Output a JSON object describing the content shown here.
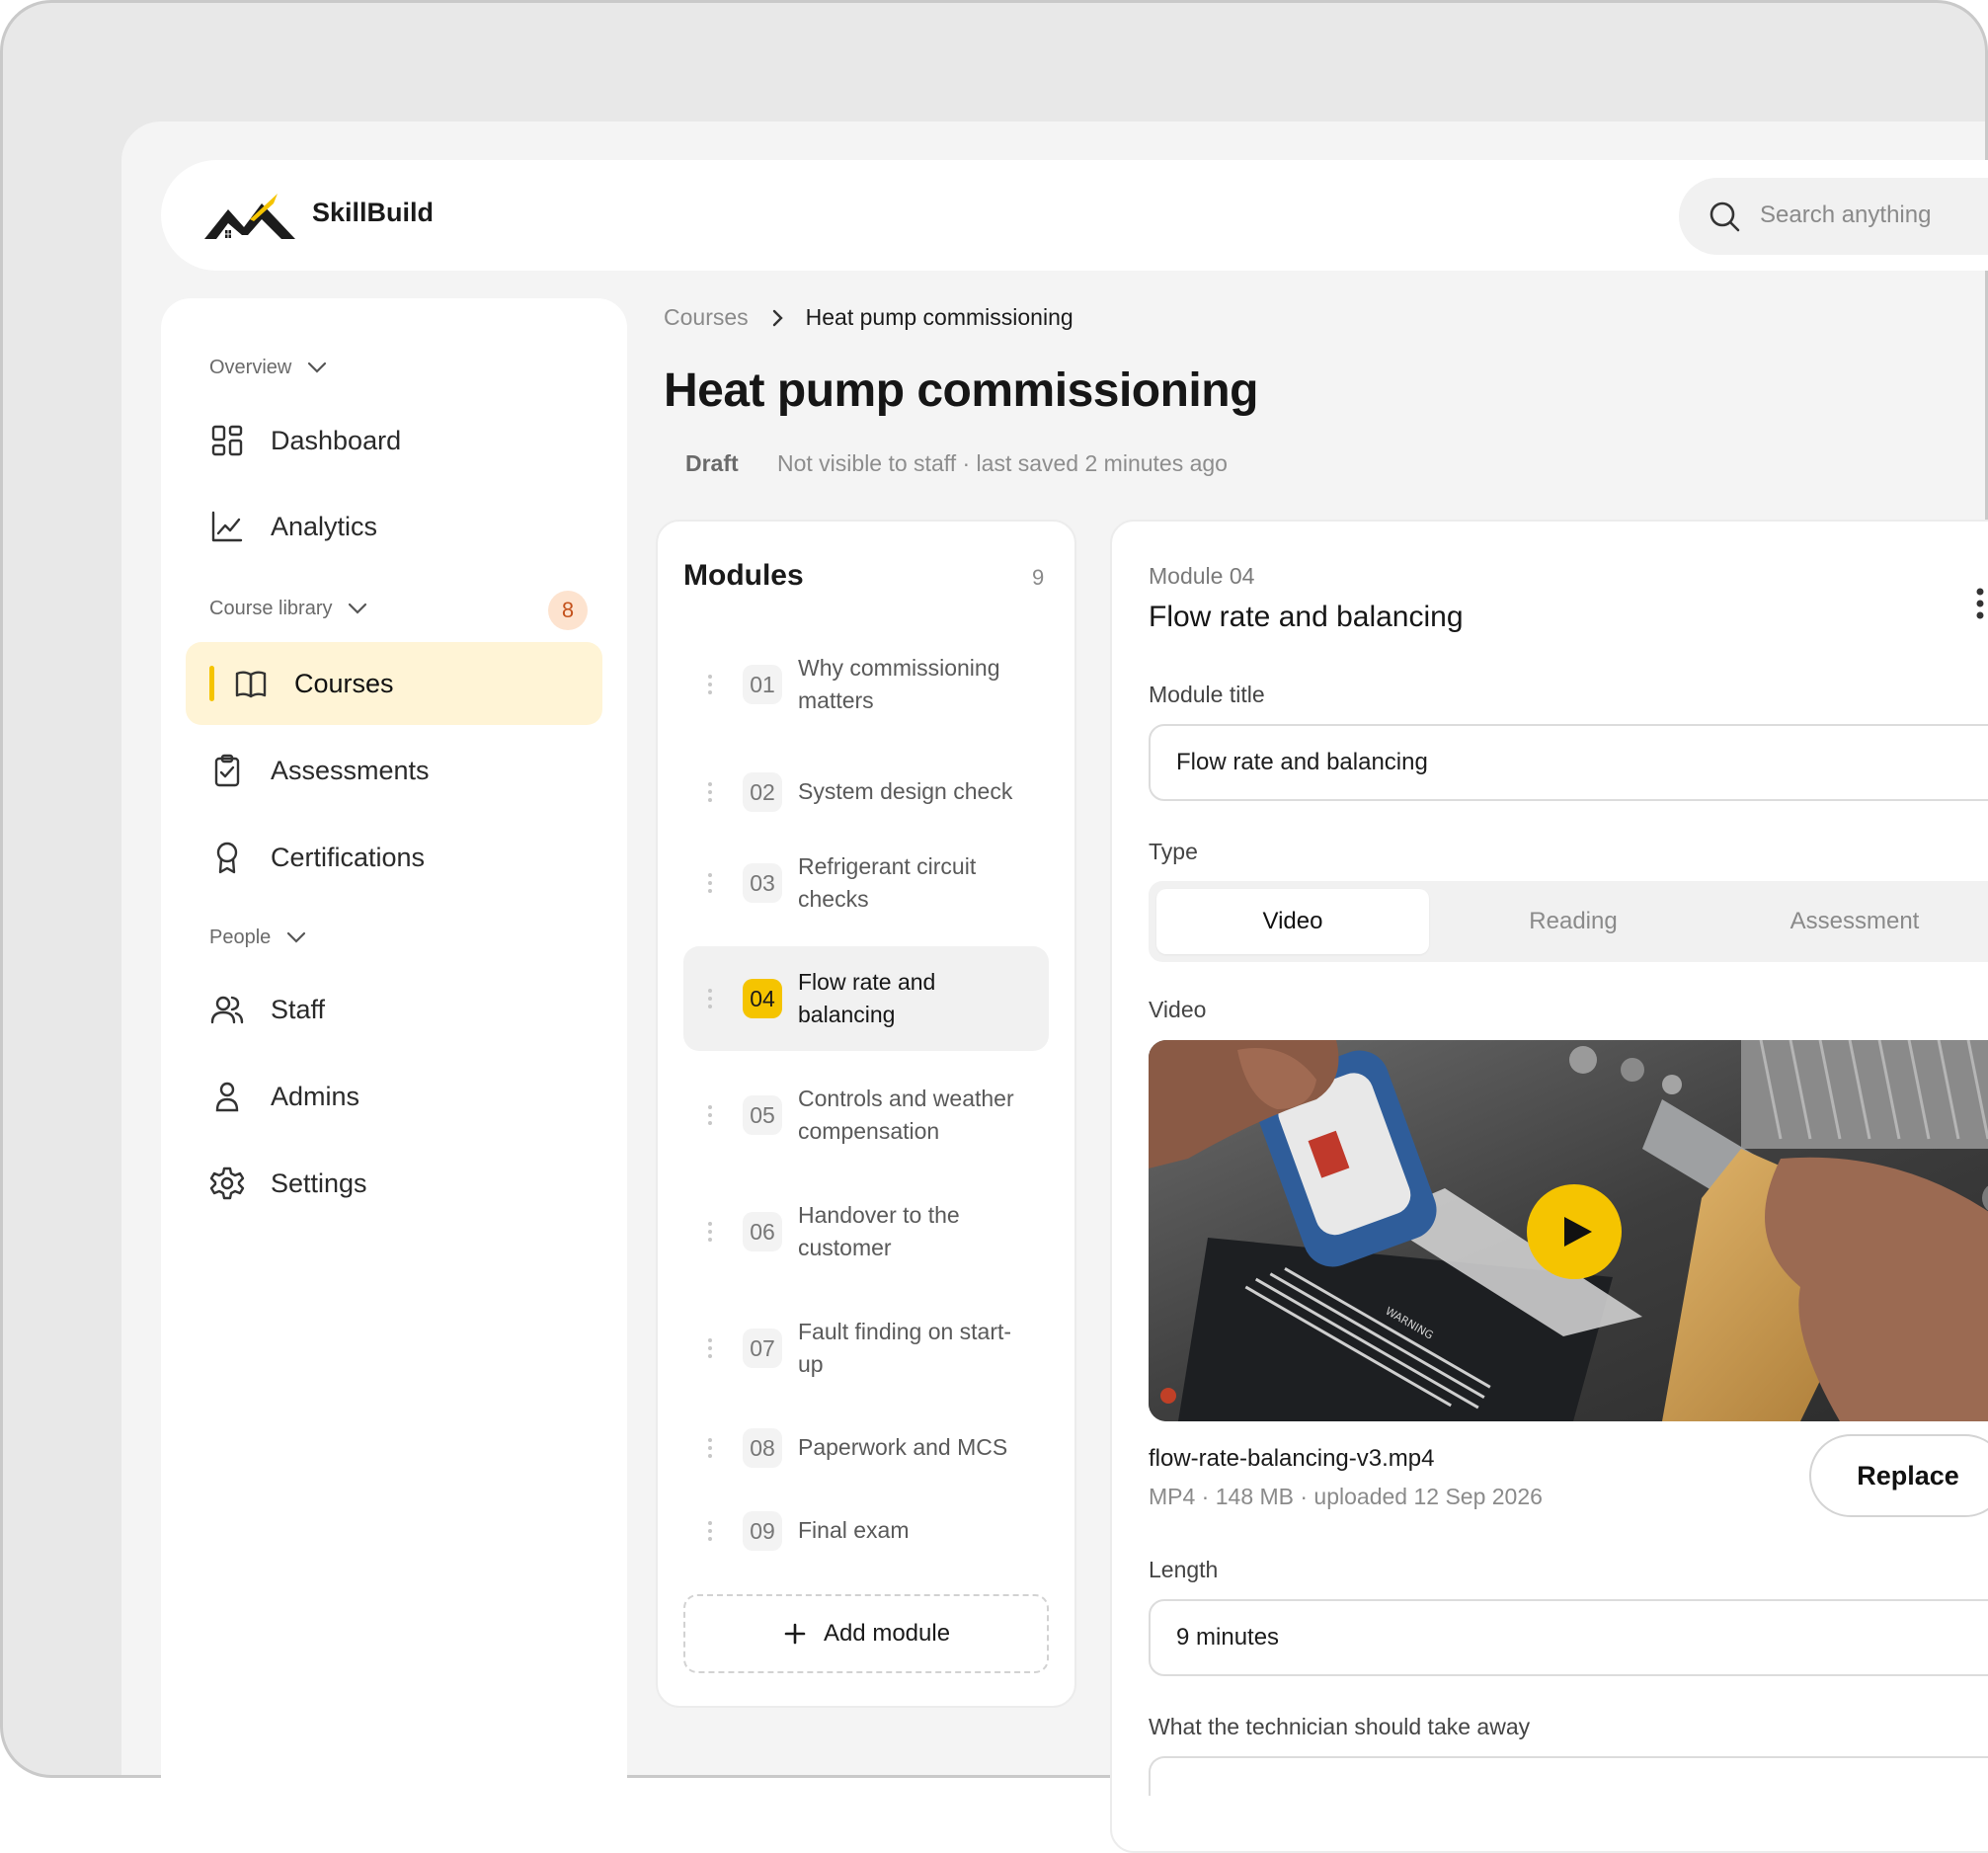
{
  "app": {
    "brand": "SkillBuild"
  },
  "search": {
    "placeholder": "Search anything"
  },
  "sidebar": {
    "groups": [
      {
        "label": "Overview"
      },
      {
        "label": "Course library",
        "badge": "8"
      },
      {
        "label": "People"
      }
    ],
    "items": [
      {
        "label": "Dashboard",
        "icon": "dashboard-grid-icon"
      },
      {
        "label": "Analytics",
        "icon": "line-chart-icon"
      },
      {
        "label": "Courses",
        "icon": "book-open-icon",
        "active": true
      },
      {
        "label": "Assessments",
        "icon": "clipboard-check-icon"
      },
      {
        "label": "Certifications",
        "icon": "award-ribbon-icon"
      },
      {
        "label": "Staff",
        "icon": "users-icon"
      },
      {
        "label": "Admins",
        "icon": "user-icon"
      },
      {
        "label": "Settings",
        "icon": "gear-icon"
      }
    ]
  },
  "breadcrumb": {
    "parent": "Courses",
    "current": "Heat pump commissioning"
  },
  "page": {
    "title": "Heat pump commissioning",
    "status": "Draft",
    "status_note": "Not visible to staff · last saved 2 minutes ago"
  },
  "modules": {
    "title": "Modules",
    "count": "9",
    "items": [
      {
        "num": "01",
        "label": "Why commissioning matters"
      },
      {
        "num": "02",
        "label": "System design check"
      },
      {
        "num": "03",
        "label": "Refrigerant circuit checks"
      },
      {
        "num": "04",
        "label": "Flow rate and balancing",
        "active": true
      },
      {
        "num": "05",
        "label": "Controls and weather compensation"
      },
      {
        "num": "06",
        "label": "Handover to the customer"
      },
      {
        "num": "07",
        "label": "Fault finding on start-up"
      },
      {
        "num": "08",
        "label": "Paperwork and MCS"
      },
      {
        "num": "09",
        "label": "Final exam"
      }
    ],
    "add_label": "Add module"
  },
  "editor": {
    "kicker": "Module 04",
    "heading": "Flow rate and balancing",
    "title_label": "Module title",
    "title_value": "Flow rate and balancing",
    "type_label": "Type",
    "types": [
      "Video",
      "Reading",
      "Assessment"
    ],
    "selected_type": "Video",
    "video_label": "Video",
    "video": {
      "file_name": "flow-rate-balancing-v3.mp4",
      "meta": "MP4 · 148 MB · uploaded 12 Sep 2026",
      "replace_label": "Replace",
      "label_text": "WARNING"
    },
    "length_label": "Length",
    "length_value": "9 minutes",
    "takeaway_label": "What the technician should take away"
  },
  "colors": {
    "accent": "#f5c400",
    "active_bg": "#fff4d6",
    "badge_bg": "#fde3cf",
    "badge_fg": "#c4521c"
  }
}
